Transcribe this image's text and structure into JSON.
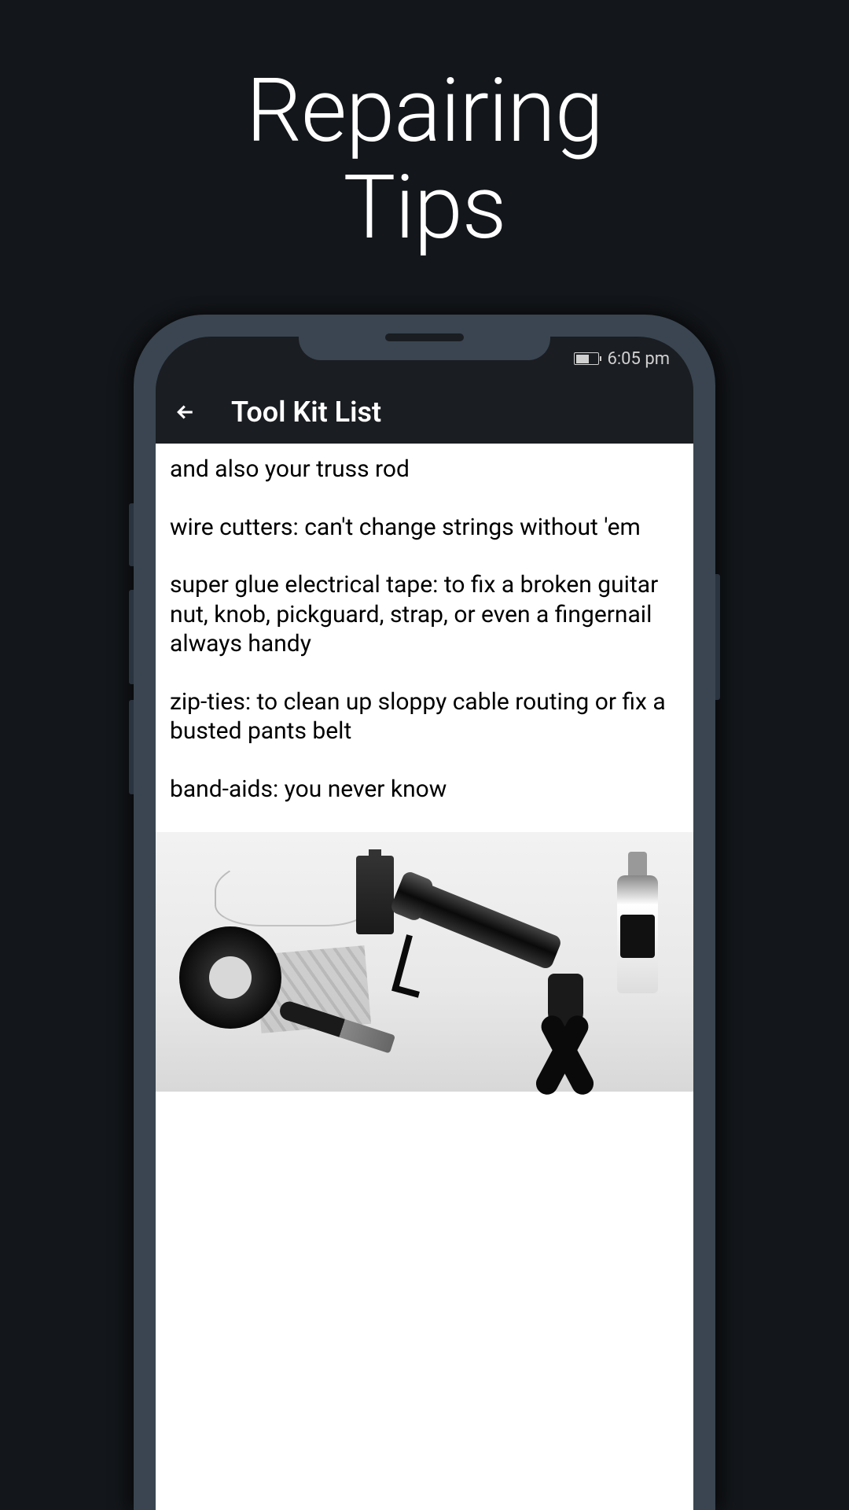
{
  "promo": {
    "title_line1": "Repairing",
    "title_line2": "Tips"
  },
  "status_bar": {
    "time": "6:05 pm"
  },
  "header": {
    "title": "Tool Kit List"
  },
  "content": {
    "paragraphs": [
      "and also your truss rod",
      " wire cutters: can't change strings without 'em",
      " super glue electrical tape: to fix a broken guitar nut, knob, pickguard, strap, or even a fingernail always handy",
      " zip-ties: to clean up sloppy cable routing or fix a busted pants belt",
      " band-aids: you never know"
    ]
  }
}
